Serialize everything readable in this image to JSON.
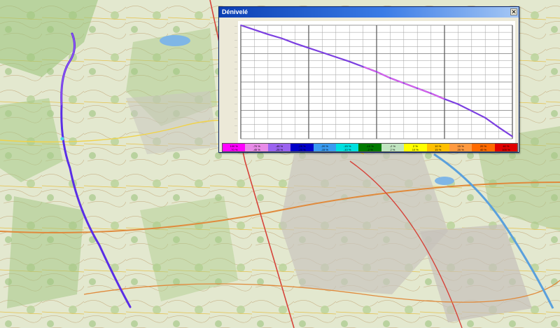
{
  "window": {
    "title": "Dénivelé",
    "close_symbol": "✕",
    "close_icon": "close-icon"
  },
  "colors": {
    "titlebar_start": "#0a3fb3",
    "titlebar_end": "#a6c8f5",
    "window_bg": "#ece9d8",
    "grid_major": "#555555",
    "grid_minor": "#9a9a9a",
    "profile_main": "#7b3fe0",
    "profile_accent": "#e060e8",
    "route_on_map": "#5a2ee6",
    "map_background": "#dfe6c9"
  },
  "map": {
    "type": "topographic-map",
    "route_icon": "route-line"
  },
  "chart_data": {
    "type": "line",
    "title": "",
    "xlabel": "",
    "ylabel": "",
    "grid": true,
    "x": [
      0,
      5,
      10,
      15,
      20,
      25,
      30,
      35,
      40,
      45,
      50,
      55,
      60,
      65,
      70,
      75,
      80,
      85,
      90,
      95,
      100
    ],
    "series": [
      {
        "values": [
          100,
          96,
          92,
          88.5,
          84,
          80,
          76,
          72,
          68,
          63.5,
          59,
          53.5,
          49,
          44.5,
          40,
          35,
          30.5,
          24.5,
          18.5,
          10,
          2
        ]
      }
    ],
    "xlim": [
      0,
      100
    ],
    "ylim": [
      0,
      100
    ],
    "y_tick_labels": [
      "—",
      "—",
      "—",
      "—",
      "—",
      "—",
      "—",
      "—",
      "—",
      "—",
      "—",
      "—",
      "—",
      "—",
      "—",
      "—"
    ],
    "legend": [
      {
        "top": "100 %",
        "bottom": "-70 %",
        "color": "#ff00ff"
      },
      {
        "top": "-70 %",
        "bottom": "-45 %",
        "color": "#e88be8"
      },
      {
        "top": "-45 %",
        "bottom": "-25 %",
        "color": "#9a63f0"
      },
      {
        "top": "-25 %",
        "bottom": "-20 %",
        "color": "#0000c8"
      },
      {
        "top": "-20 %",
        "bottom": "-15 %",
        "color": "#3a9bf0"
      },
      {
        "top": "-15 %",
        "bottom": "-10 %",
        "color": "#00e0e0"
      },
      {
        "top": "-10 %",
        "bottom": "-2 %",
        "color": "#007a00"
      },
      {
        "top": "-2 %",
        "bottom": "2 %",
        "color": "#c0e4c0"
      },
      {
        "top": "2 %",
        "bottom": "10 %",
        "color": "#ffff00"
      },
      {
        "top": "10 %",
        "bottom": "15 %",
        "color": "#ffc000"
      },
      {
        "top": "15 %",
        "bottom": "20 %",
        "color": "#ff9a40"
      },
      {
        "top": "20 %",
        "bottom": "40 %",
        "color": "#ff6a00"
      },
      {
        "top": "40 %",
        "bottom": "100 %",
        "color": "#e00000"
      }
    ]
  }
}
